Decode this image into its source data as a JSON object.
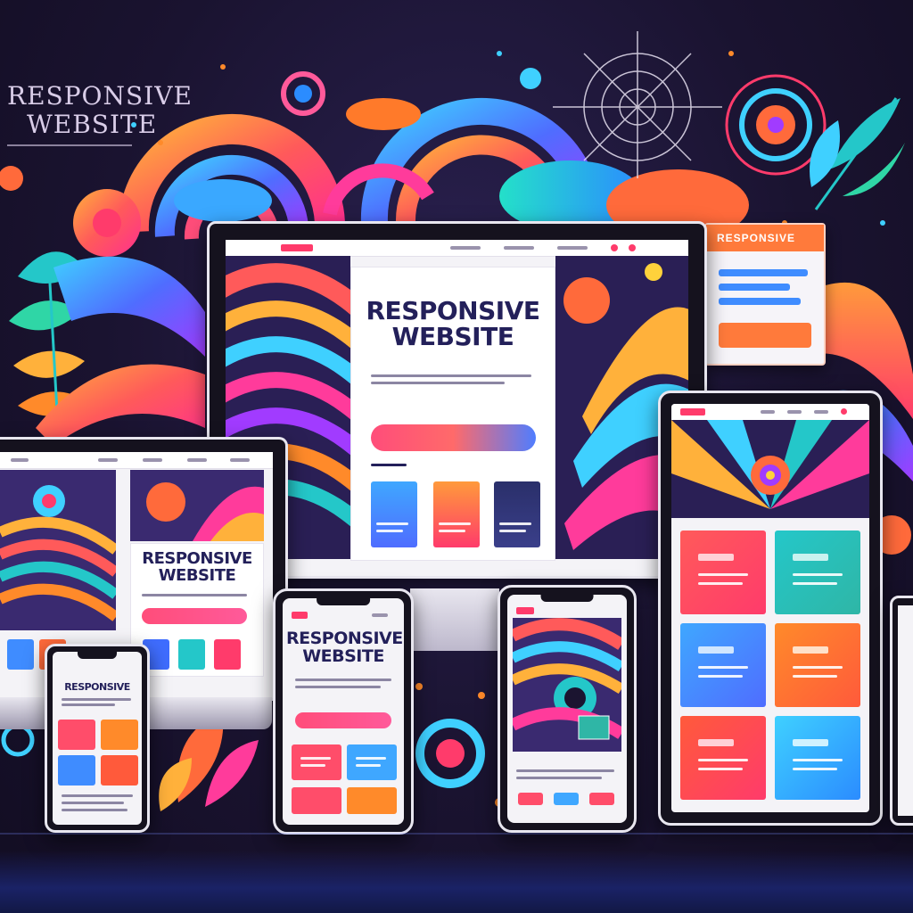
{
  "corner_title": {
    "line1": "RESPONSIVE",
    "line2": "WEBSITE"
  },
  "monitor": {
    "hero_line1": "RESPONSIVE",
    "hero_line2": "WEBSITE"
  },
  "laptop": {
    "hero_line1": "RESPONSIVE",
    "hero_line2": "WEBSITE"
  },
  "phone_center": {
    "hero_line1": "RESPONSIVE",
    "hero_line2": "WEBSITE"
  },
  "phone_small": {
    "hero_line1": "RESPONSIVE"
  },
  "popup_card": {
    "label": "RESPONSIVE"
  },
  "colors": {
    "background": "#1b1430",
    "accent_pink": "#ff3b6b",
    "accent_orange": "#ff8a2a",
    "accent_blue": "#3fa7ff",
    "accent_teal": "#24c7c9",
    "title_navy": "#23205a"
  },
  "icons": [
    "crosshair-icon",
    "leaf-icon",
    "cloud-icon",
    "target-icon",
    "swirl-icon"
  ]
}
